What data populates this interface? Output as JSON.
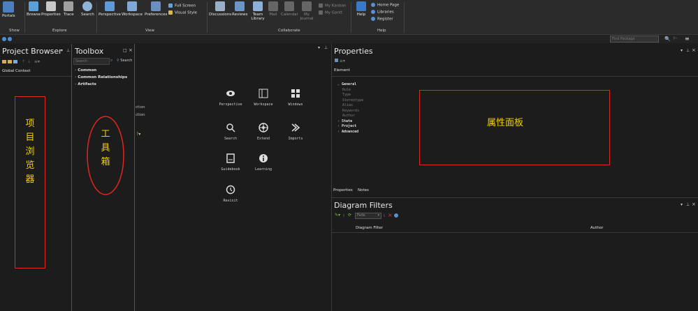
{
  "ribbon": {
    "buttons": [
      {
        "label": "Portals",
        "icon": "home-icon"
      },
      {
        "label": "Browse",
        "icon": "browse-icon"
      },
      {
        "label": "Properties",
        "icon": "properties-icon"
      },
      {
        "label": "Trace",
        "icon": "trace-icon"
      },
      {
        "label": "Search",
        "icon": "search-icon"
      },
      {
        "label": "Perspective",
        "icon": "perspective-icon"
      },
      {
        "label": "Workspace",
        "icon": "workspace-icon"
      },
      {
        "label": "Preferences",
        "icon": "preferences-icon"
      },
      {
        "label": "Discussions",
        "icon": "discussions-icon"
      },
      {
        "label": "Reviews",
        "icon": "reviews-icon"
      },
      {
        "label": "Team Library",
        "icon": "team-library-icon"
      },
      {
        "label": "Mail",
        "icon": "mail-icon"
      },
      {
        "label": "Calendar",
        "icon": "calendar-icon"
      },
      {
        "label": "My Journal",
        "icon": "journal-icon"
      },
      {
        "label": "Help",
        "icon": "help-icon"
      }
    ],
    "view_small": {
      "full_screen": "Full Screen",
      "visual_style": "Visual Style"
    },
    "collab_small": {
      "my_kanban": "My Kanban",
      "my_gantt": "My Gantt"
    },
    "help_small": {
      "home_page": "Home Page",
      "libraries": "Libraries",
      "register": "Register"
    },
    "groups": {
      "show": "Show",
      "explore": "Explore",
      "view": "View",
      "collaborate": "Collaborate",
      "help": "Help"
    }
  },
  "find_package": {
    "placeholder": "Find Package"
  },
  "project_browser": {
    "title": "Project Browser",
    "tabs": [
      "Global",
      "Context"
    ]
  },
  "toolbox": {
    "title": "Toolbox",
    "search_placeholder": "Search",
    "search_button": "Search",
    "items": [
      "Common",
      "Common Relationships",
      "Artifacts"
    ]
  },
  "start_page": {
    "partial_labels": [
      "ction",
      "ction"
    ],
    "tiles": [
      {
        "label": "Perspective",
        "icon": "eye-icon"
      },
      {
        "label": "Workspace",
        "icon": "workspace-icon"
      },
      {
        "label": "Windows",
        "icon": "windows-icon"
      },
      {
        "label": "Search",
        "icon": "search-icon"
      },
      {
        "label": "Extend",
        "icon": "extend-icon"
      },
      {
        "label": "Imports",
        "icon": "import-icon"
      },
      {
        "label": "Guidebook",
        "icon": "guidebook-icon"
      },
      {
        "label": "Learning",
        "icon": "info-icon"
      },
      {
        "label": "Revisit",
        "icon": "history-icon"
      }
    ]
  },
  "properties": {
    "title": "Properties",
    "element_tab": "Element",
    "tree": [
      {
        "label": "General",
        "bold": true
      },
      {
        "label": "Rule",
        "bold": false
      },
      {
        "label": "Type",
        "bold": false
      },
      {
        "label": "Stereotype",
        "bold": false
      },
      {
        "label": "Alias",
        "bold": false
      },
      {
        "label": "Keywords",
        "bold": false
      },
      {
        "label": "Author",
        "bold": false
      },
      {
        "label": "State",
        "bold": true
      },
      {
        "label": "Project",
        "bold": true
      },
      {
        "label": "Advanced",
        "bold": true
      }
    ],
    "bottom_tabs": [
      "Properties",
      "Notes"
    ]
  },
  "diagram_filters": {
    "title": "Diagram Filters",
    "dropdown_value": "Fade",
    "columns": [
      "Diagram Filter",
      "Author"
    ]
  },
  "annotations": {
    "project_browser_zh": "项目浏览器",
    "toolbox_zh": "工具箱",
    "properties_zh": "属性面板"
  },
  "colors": {
    "ribbon_bg": "#2b2b2b",
    "panel_bg": "#1c1c1c",
    "annotation": "#e0261f",
    "annotation_text": "#f2d000"
  }
}
